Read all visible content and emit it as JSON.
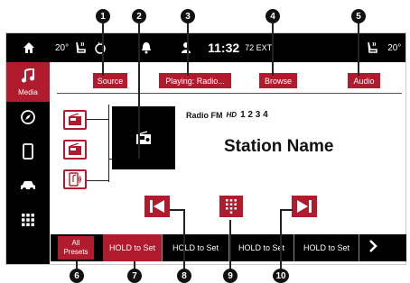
{
  "callouts": [
    "1",
    "2",
    "3",
    "4",
    "5",
    "6",
    "7",
    "8",
    "9",
    "10"
  ],
  "status_bar": {
    "home_icon": "home-icon",
    "driver_temp": "20°",
    "driver_seat_icon": "heated-seat-icon",
    "bell_icon": "notification-bell-icon",
    "profile_icon": "user-profile-icon",
    "clock": "11:32",
    "outside_temp": "72 EXT",
    "passenger_seat_icon": "heated-seat-icon",
    "passenger_temp": "20°"
  },
  "sidebar": {
    "items": [
      {
        "label": "Media",
        "icon": "music-note-icon",
        "active": true
      },
      {
        "label": "",
        "icon": "compass-icon",
        "active": false
      },
      {
        "label": "",
        "icon": "phone-icon",
        "active": false
      },
      {
        "label": "",
        "icon": "car-icon",
        "active": false
      },
      {
        "label": "",
        "icon": "apps-grid-icon",
        "active": false
      }
    ]
  },
  "tabs": {
    "source": "Source",
    "playing": "Playing: Radio...",
    "browse": "Browse",
    "audio": "Audio"
  },
  "now_playing": {
    "source_name": "Radio FM",
    "hd_label": "HD",
    "hd_channels": "1 2 3 4",
    "station_name": "Station Name"
  },
  "source_icons": [
    "radio-am-icon",
    "radio-fm-icon",
    "media-player-icon"
  ],
  "controls": [
    "seek-back-icon",
    "direct-tune-icon",
    "seek-forward-icon"
  ],
  "bottom_bar": {
    "presets_label_line1": "All",
    "presets_label_line2": "Presets",
    "slots": [
      "HOLD to Set",
      "HOLD to Set",
      "HOLD to Set",
      "HOLD to Set"
    ],
    "next_icon": "chevron-right-icon"
  },
  "colors": {
    "accent": "#b01c2e",
    "bar": "#000000"
  }
}
